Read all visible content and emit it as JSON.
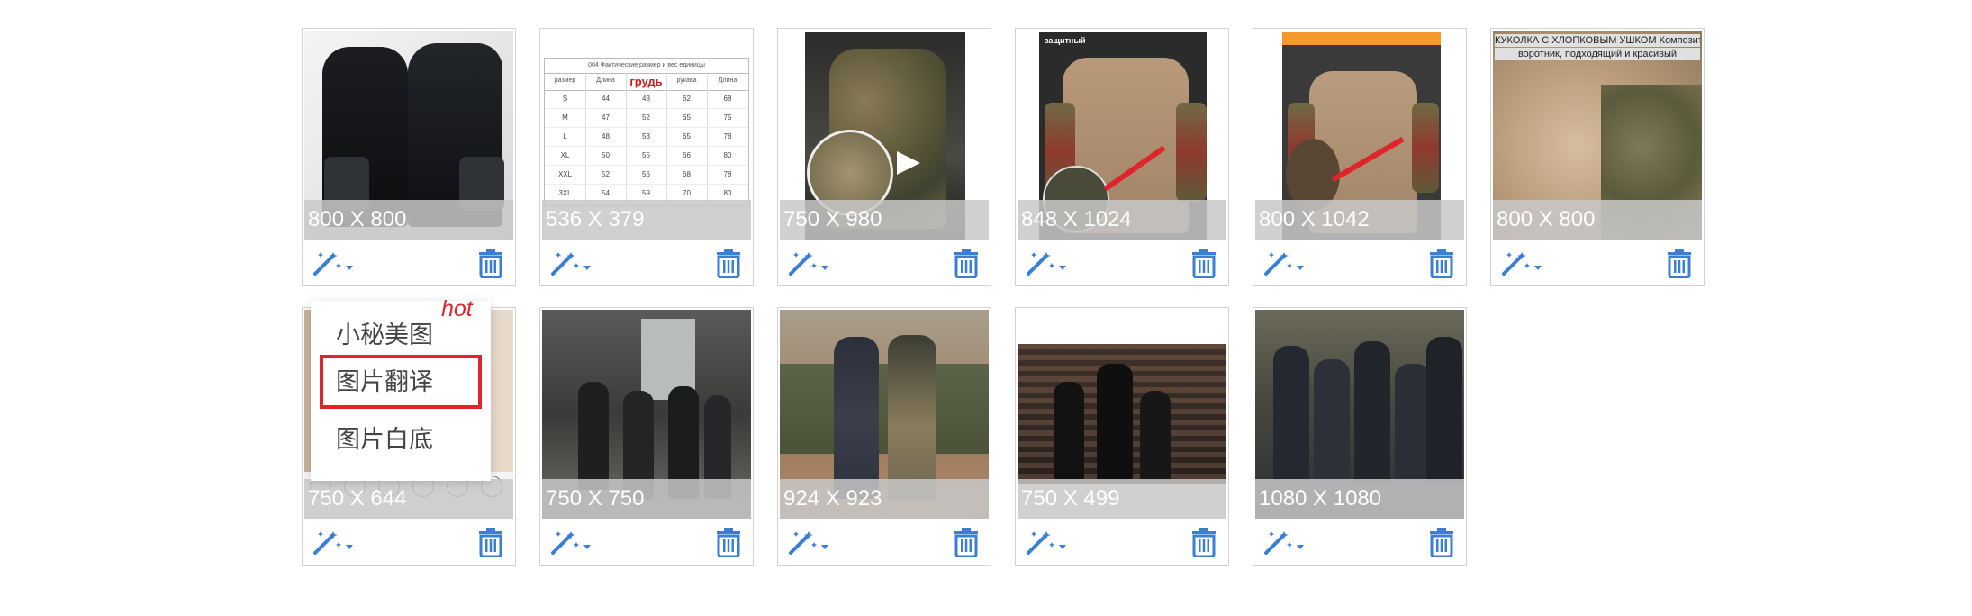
{
  "colors": {
    "accent": "#3a7fd5",
    "menu_highlight": "#e0242b",
    "dim_overlay": "#c8c8c8"
  },
  "images": [
    {
      "dimensions": "800 X 800",
      "thumb": "black tactical shirt"
    },
    {
      "dimensions": "536 X 379",
      "thumb": "size chart table",
      "thumb_text": {
        "caption": "004 Фактические размер и вес единицы",
        "header": [
          "размер",
          "Длина",
          "грудь",
          "рукава",
          "Длина"
        ],
        "rows": [
          [
            "S",
            "44",
            "48",
            "62",
            "68"
          ],
          [
            "M",
            "47",
            "52",
            "65",
            "75"
          ],
          [
            "L",
            "48",
            "53",
            "65",
            "78"
          ],
          [
            "XL",
            "50",
            "55",
            "66",
            "80"
          ],
          [
            "XXL",
            "52",
            "56",
            "68",
            "78"
          ],
          [
            "3XL",
            "54",
            "59",
            "70",
            "80"
          ]
        ]
      }
    },
    {
      "dimensions": "750 X 980",
      "thumb": "camo combat shirt"
    },
    {
      "dimensions": "848 X 1024",
      "thumb": "tan camo shirt detail",
      "thumb_text": {
        "label": "защитный"
      }
    },
    {
      "dimensions": "800 X 1042",
      "thumb": "tan camo shirt orange header"
    },
    {
      "dimensions": "800 X 800",
      "thumb": "shirt collar closeup",
      "thumb_text": {
        "line1": "КУКОЛКА С ХЛОПКОВЫМ УШКОМ Композитный",
        "line2": "воротник, подходящий и красивый"
      }
    },
    {
      "dimensions": "750 X 644",
      "thumb": "product icons"
    },
    {
      "dimensions": "750 X 750",
      "thumb": "soldiers walking hangar"
    },
    {
      "dimensions": "924 X 923",
      "thumb": "two soldiers vehicle"
    },
    {
      "dimensions": "750 X 499",
      "thumb": "soldiers dark"
    },
    {
      "dimensions": "1080 X 1080",
      "thumb": "group of soldiers truck"
    }
  ],
  "menu": {
    "items": [
      "小秘美图",
      "图片翻译",
      "图片白底"
    ],
    "hot_badge": "hot",
    "selected_index": 1
  },
  "icons": {
    "tool": "magic-wand-icon",
    "dropdown": "caret-down-icon",
    "delete": "trash-icon"
  }
}
